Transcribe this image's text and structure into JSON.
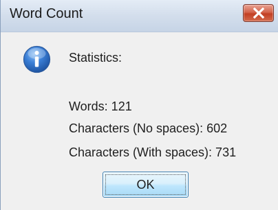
{
  "window": {
    "title": "Word Count"
  },
  "icons": {
    "title_close": "close-icon",
    "message": "info-icon"
  },
  "content": {
    "heading": "Statistics:",
    "words": "Words: 121",
    "chars_no_spaces": "Characters (No spaces): 602",
    "chars_with_spaces": "Characters (With spaces): 731"
  },
  "buttons": {
    "ok_label": "OK"
  },
  "colors": {
    "close_button": "#c23f23",
    "icon_blue": "#2f6fc4",
    "ok_button": "#bee6fd"
  }
}
